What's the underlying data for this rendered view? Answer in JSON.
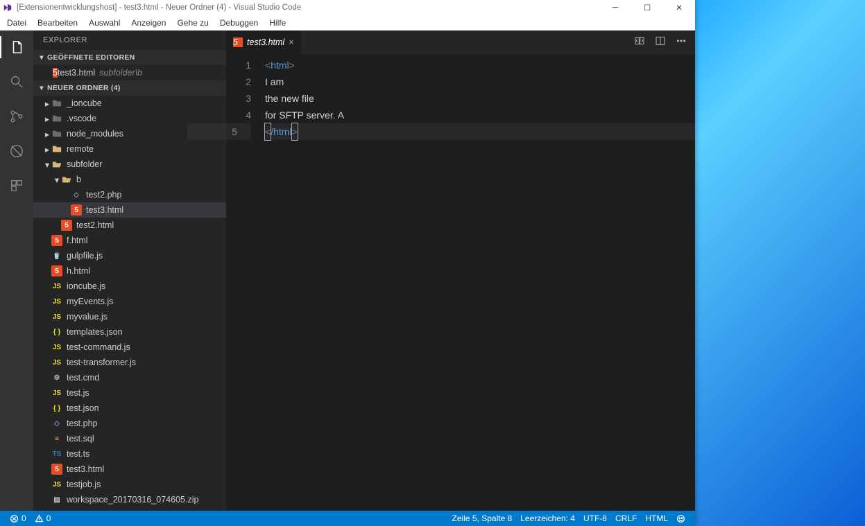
{
  "window": {
    "title": "[Extensionentwicklungshost] - test3.html - Neuer Ordner (4) - Visual Studio Code"
  },
  "menubar": [
    "Datei",
    "Bearbeiten",
    "Auswahl",
    "Anzeigen",
    "Gehe zu",
    "Debuggen",
    "Hilfe"
  ],
  "sidebar": {
    "header": "EXPLORER",
    "open_editors_section": "GEÖFFNETE EDITOREN",
    "open_editor": {
      "name": "test3.html",
      "path": "subfolder\\b",
      "icon": "html"
    },
    "workspace_section": "NEUER ORDNER (4)",
    "tree": [
      {
        "depth": 0,
        "kind": "folderdot",
        "chev": "right",
        "name": "_ioncube"
      },
      {
        "depth": 0,
        "kind": "folderdot",
        "chev": "right",
        "name": ".vscode"
      },
      {
        "depth": 0,
        "kind": "folderdot",
        "chev": "right",
        "name": "node_modules"
      },
      {
        "depth": 0,
        "kind": "folder",
        "chev": "right",
        "name": "remote"
      },
      {
        "depth": 0,
        "kind": "folder",
        "chev": "down",
        "name": "subfolder",
        "open": true
      },
      {
        "depth": 1,
        "kind": "folder",
        "chev": "down",
        "name": "b",
        "open": true
      },
      {
        "depth": 2,
        "kind": "php",
        "name": "test2.php"
      },
      {
        "depth": 2,
        "kind": "html",
        "name": "test3.html",
        "selected": true
      },
      {
        "depth": 1,
        "kind": "html",
        "name": "test2.html"
      },
      {
        "depth": 0,
        "kind": "html",
        "name": "f.html"
      },
      {
        "depth": 0,
        "kind": "gulp",
        "name": "gulpfile.js"
      },
      {
        "depth": 0,
        "kind": "html",
        "name": "h.html"
      },
      {
        "depth": 0,
        "kind": "js",
        "name": "ioncube.js"
      },
      {
        "depth": 0,
        "kind": "js",
        "name": "myEvents.js"
      },
      {
        "depth": 0,
        "kind": "js",
        "name": "myvalue.js"
      },
      {
        "depth": 0,
        "kind": "json",
        "name": "templates.json"
      },
      {
        "depth": 0,
        "kind": "js",
        "name": "test-command.js"
      },
      {
        "depth": 0,
        "kind": "js",
        "name": "test-transformer.js"
      },
      {
        "depth": 0,
        "kind": "cmd",
        "name": "test.cmd"
      },
      {
        "depth": 0,
        "kind": "js",
        "name": "test.js"
      },
      {
        "depth": 0,
        "kind": "json",
        "name": "test.json"
      },
      {
        "depth": 0,
        "kind": "php",
        "name": "test.php"
      },
      {
        "depth": 0,
        "kind": "sql",
        "name": "test.sql"
      },
      {
        "depth": 0,
        "kind": "ts",
        "name": "test.ts"
      },
      {
        "depth": 0,
        "kind": "html",
        "name": "test3.html"
      },
      {
        "depth": 0,
        "kind": "js",
        "name": "testjob.js"
      },
      {
        "depth": 0,
        "kind": "zip",
        "name": "workspace_20170316_074605.zip"
      }
    ]
  },
  "editor": {
    "tab_name": "test3.html",
    "tab_icon": "html",
    "lines": [
      {
        "n": "1",
        "pre": "<",
        "tag": "html",
        "post": ">",
        "text": ""
      },
      {
        "n": "2",
        "plain": "I am"
      },
      {
        "n": "3",
        "plain": "the new file"
      },
      {
        "n": "4",
        "plain": "for SFTP server. A"
      },
      {
        "n": "5",
        "pre": "<",
        "tag": "/html",
        "post": ">",
        "current": true
      }
    ]
  },
  "statusbar": {
    "errors": "0",
    "warnings": "0",
    "cursor": "Zeile 5, Spalte 8",
    "indent": "Leerzeichen: 4",
    "encoding": "UTF-8",
    "eol": "CRLF",
    "lang": "HTML"
  },
  "icons": {
    "html": "5",
    "js": "JS",
    "json": "{ }",
    "php": "◇",
    "sql": "≡",
    "ts": "TS",
    "cmd": "⚙",
    "gulp": "🥤",
    "zip": "▤"
  }
}
